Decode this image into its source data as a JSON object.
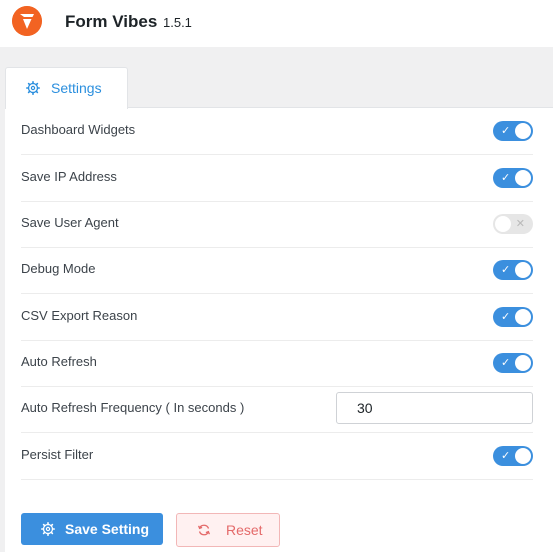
{
  "header": {
    "app_name": "Form Vibes",
    "version": "1.5.1",
    "logo_icon": "form-vibes-logo",
    "brand_color": "#f26322"
  },
  "tabs": [
    {
      "label": "Settings",
      "icon": "gear-icon",
      "active": true
    }
  ],
  "settings": [
    {
      "label": "Dashboard Widgets",
      "enabled": true
    },
    {
      "label": "Save IP Address",
      "enabled": true
    },
    {
      "label": "Save User Agent",
      "enabled": false
    },
    {
      "label": "Debug Mode",
      "enabled": true
    },
    {
      "label": "CSV Export Reason",
      "enabled": true
    },
    {
      "label": "Auto Refresh",
      "enabled": true
    },
    {
      "label": "Auto Refresh Frequency ( In seconds )",
      "value": "30"
    },
    {
      "label": "Persist Filter",
      "enabled": true
    }
  ],
  "toggle_marks": {
    "on": "✓",
    "off": "✕"
  },
  "buttons": {
    "save_label": "Save Setting",
    "save_icon": "gear-icon",
    "reset_label": "Reset",
    "reset_icon": "refresh-icon"
  },
  "colors": {
    "accent": "#3b8fde",
    "toggle_off": "#e6e6e6",
    "reset_text": "#e46a6a"
  }
}
